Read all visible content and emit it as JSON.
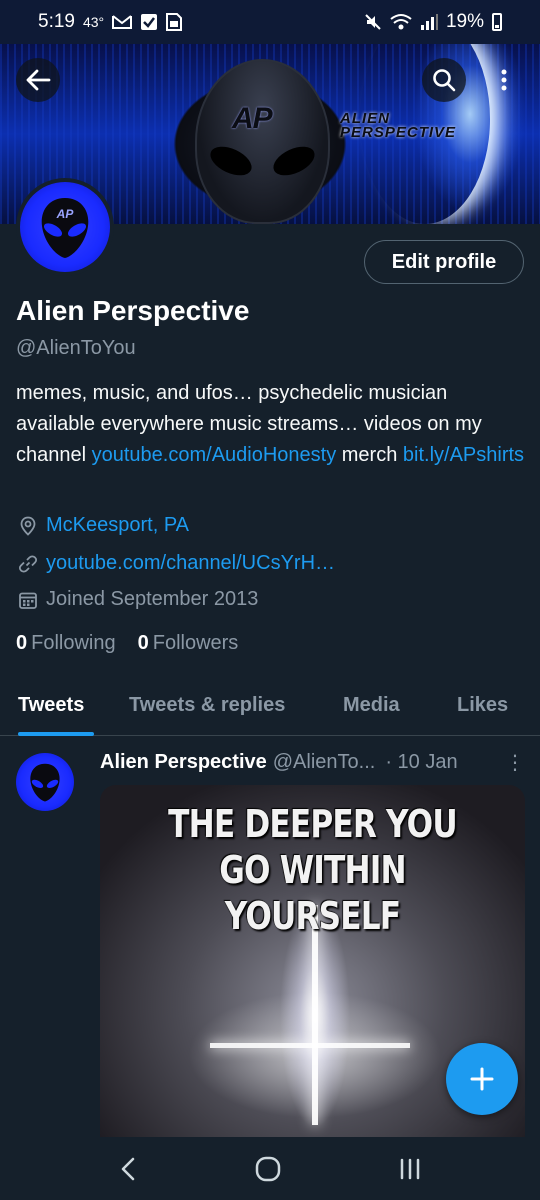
{
  "status_bar": {
    "time": "5:19",
    "temperature": "43°",
    "battery": "19%",
    "icons": [
      "gmail-icon",
      "checkbox-icon",
      "sim-icon",
      "mute-icon",
      "wifi-icon",
      "signal-icon",
      "battery-icon"
    ]
  },
  "banner": {
    "logo_text": "AP",
    "brand_line1": "ALIEN",
    "brand_line2": "PERSPECTIVE"
  },
  "header_buttons": [
    "back-icon",
    "search-icon",
    "more-vertical-icon"
  ],
  "profile": {
    "avatar_text": "AP",
    "edit_label": "Edit profile",
    "name": "Alien Perspective",
    "handle": "@AlienToYou",
    "bio_part1": "memes, music, and ufos… psychedelic musician available everywhere music streams… videos on my channel ",
    "bio_link1": "youtube.com/AudioHonesty",
    "bio_part2": " merch ",
    "bio_link2": "bit.ly/APshirts",
    "location": "McKeesport, PA",
    "website": "youtube.com/channel/UCsYrH…",
    "joined": "Joined September 2013",
    "following_count": "0",
    "following_label": "Following",
    "followers_count": "0",
    "followers_label": "Followers"
  },
  "tabs": [
    {
      "label": "Tweets",
      "active": true
    },
    {
      "label": "Tweets & replies",
      "active": false
    },
    {
      "label": "Media",
      "active": false
    },
    {
      "label": "Likes",
      "active": false
    }
  ],
  "tweet": {
    "author": "Alien Perspective",
    "handle": "@AlienTo...",
    "date": "· 10 Jan",
    "more": "⋮",
    "image_text_line1": "THE DEEPER YOU",
    "image_text_line2": "GO WITHIN YOURSELF"
  },
  "fab": {
    "icon": "compose-plus-icon",
    "label": "+"
  },
  "nav": [
    "back-nav-icon",
    "home-nav-icon",
    "recents-nav-icon"
  ],
  "colors": {
    "background": "#15202b",
    "accent": "#1d9bf0",
    "muted": "#8b98a5",
    "avatar_blue": "#1a2bff"
  }
}
